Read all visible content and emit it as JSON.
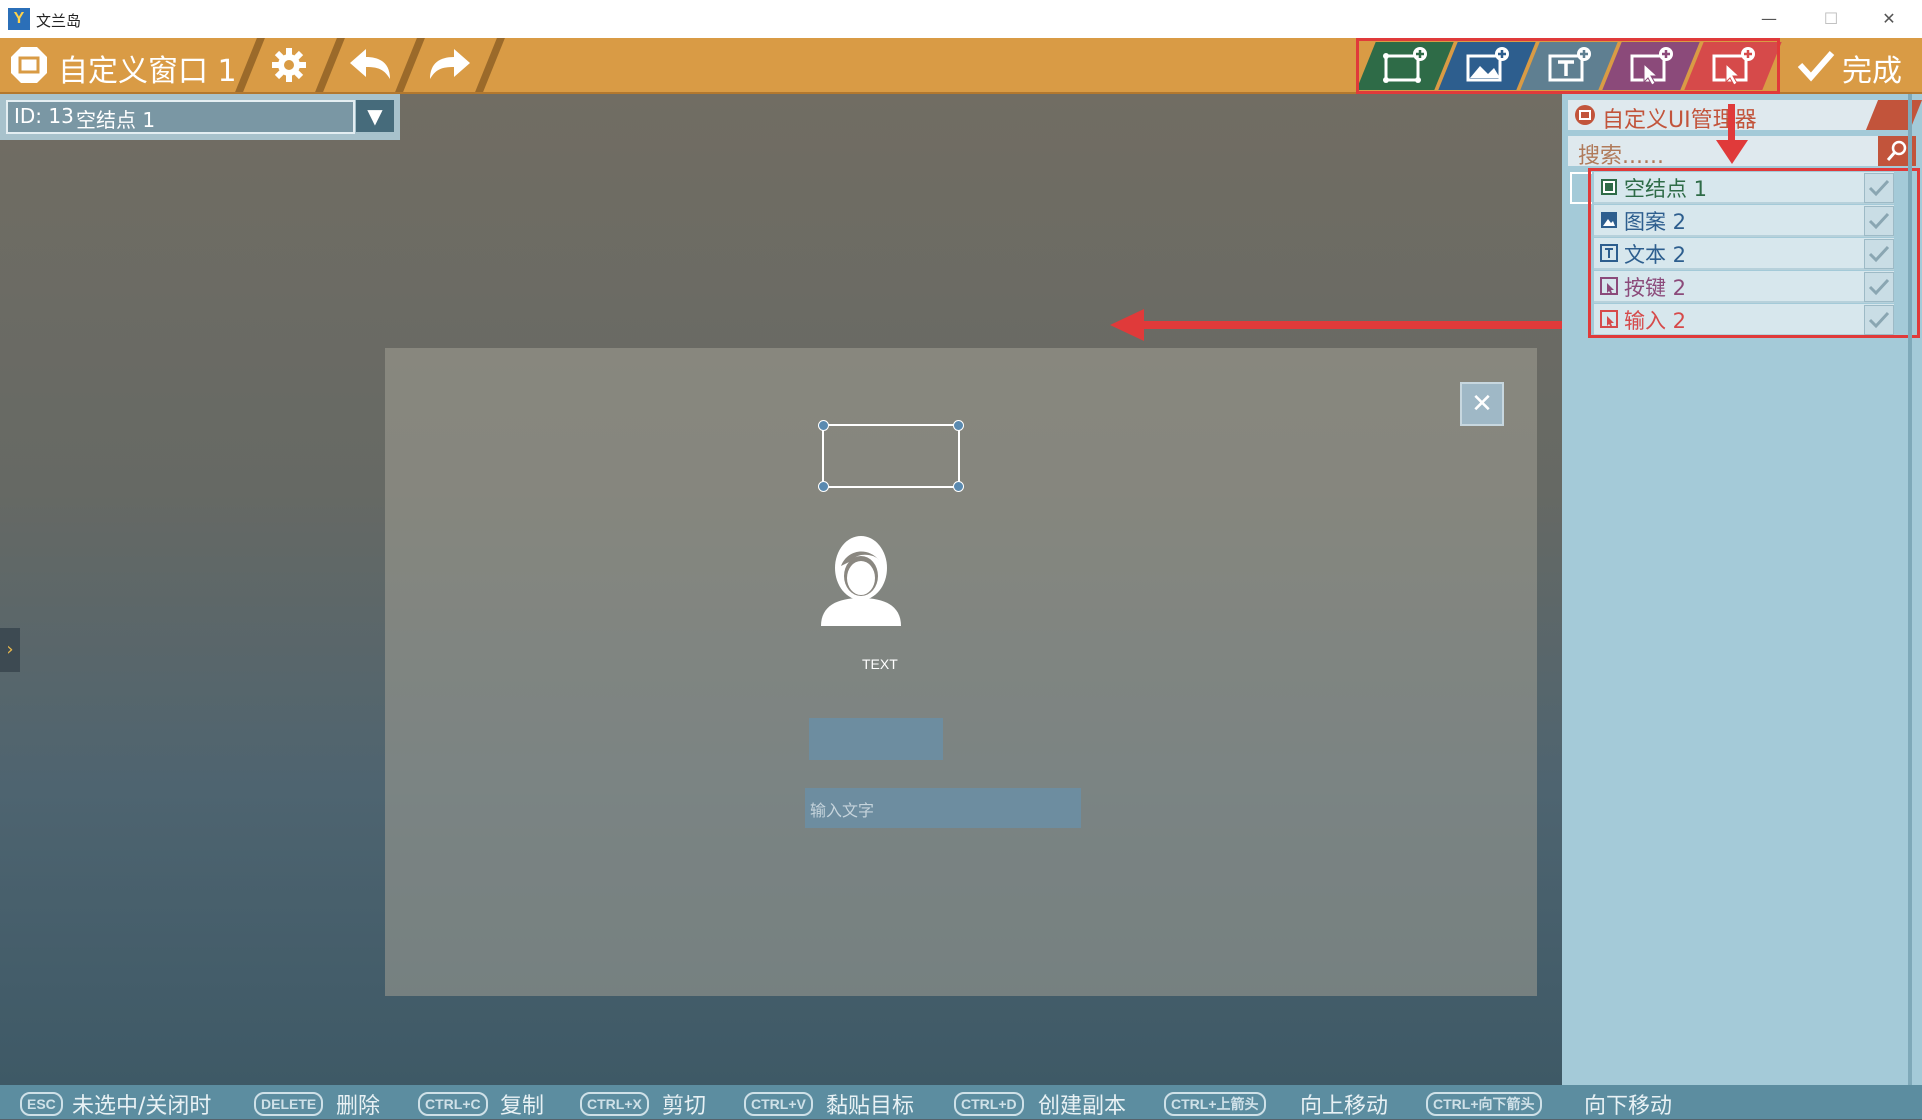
{
  "window": {
    "title": "文兰岛",
    "app_icon_glyph": "Y",
    "controls": [
      "—",
      "☐",
      "✕"
    ]
  },
  "toolbar": {
    "window_name": "自定义窗口 1",
    "done_label": "完成",
    "tool_icons": [
      "settings-icon",
      "undo-icon",
      "redo-icon"
    ],
    "add_buttons": [
      {
        "name": "add-empty-node-button",
        "icon": "add-node-icon",
        "color": "#2e6b47"
      },
      {
        "name": "add-image-button",
        "icon": "add-image-icon",
        "color": "#2d5e8e"
      },
      {
        "name": "add-text-button",
        "icon": "add-text-icon",
        "color": "#5f7f91"
      },
      {
        "name": "add-button-button",
        "icon": "add-button-icon",
        "color": "#8b4a7a"
      },
      {
        "name": "add-input-button",
        "icon": "add-input-icon",
        "color": "#d64a4a"
      }
    ]
  },
  "id_bar": {
    "id_label": "ID: 13",
    "node_name": "空结点 1",
    "dropdown_glyph": "▼"
  },
  "canvas": {
    "text_label": "TEXT",
    "input_placeholder": "输入文字",
    "close_glyph": "✕",
    "side_tab_glyph": "›"
  },
  "manager": {
    "title": "自定义UI管理器",
    "search_placeholder": "搜索......",
    "nodes": [
      {
        "label": "空结点 1",
        "color": "#2e6b47",
        "icon": "empty-node-icon",
        "checked": true
      },
      {
        "label": "图案 2",
        "color": "#2d5e8e",
        "icon": "image-node-icon",
        "checked": true
      },
      {
        "label": "文本 2",
        "color": "#2d5e8e",
        "icon": "text-node-icon",
        "checked": true
      },
      {
        "label": "按键 2",
        "color": "#8b4a7a",
        "icon": "button-node-icon",
        "checked": true
      },
      {
        "label": "输入 2",
        "color": "#d64a4a",
        "icon": "input-node-icon",
        "checked": true
      }
    ]
  },
  "shortcuts": [
    {
      "key": "ESC",
      "desc": "未选中/关闭时"
    },
    {
      "key": "DELETE",
      "desc": "删除"
    },
    {
      "key": "CTRL+C",
      "desc": "复制"
    },
    {
      "key": "CTRL+X",
      "desc": "剪切"
    },
    {
      "key": "CTRL+V",
      "desc": "黏贴目标"
    },
    {
      "key": "CTRL+D",
      "desc": "创建副本"
    },
    {
      "key": "CTRL+上箭头",
      "desc": "向上移动"
    },
    {
      "key": "CTRL+向下箭头",
      "desc": "向下移动"
    }
  ],
  "colors": {
    "toolbar": "#d99b45",
    "manager": "#a4cad8",
    "annotation": "#e03a3a",
    "bottom_bar": "#5c8da0"
  }
}
